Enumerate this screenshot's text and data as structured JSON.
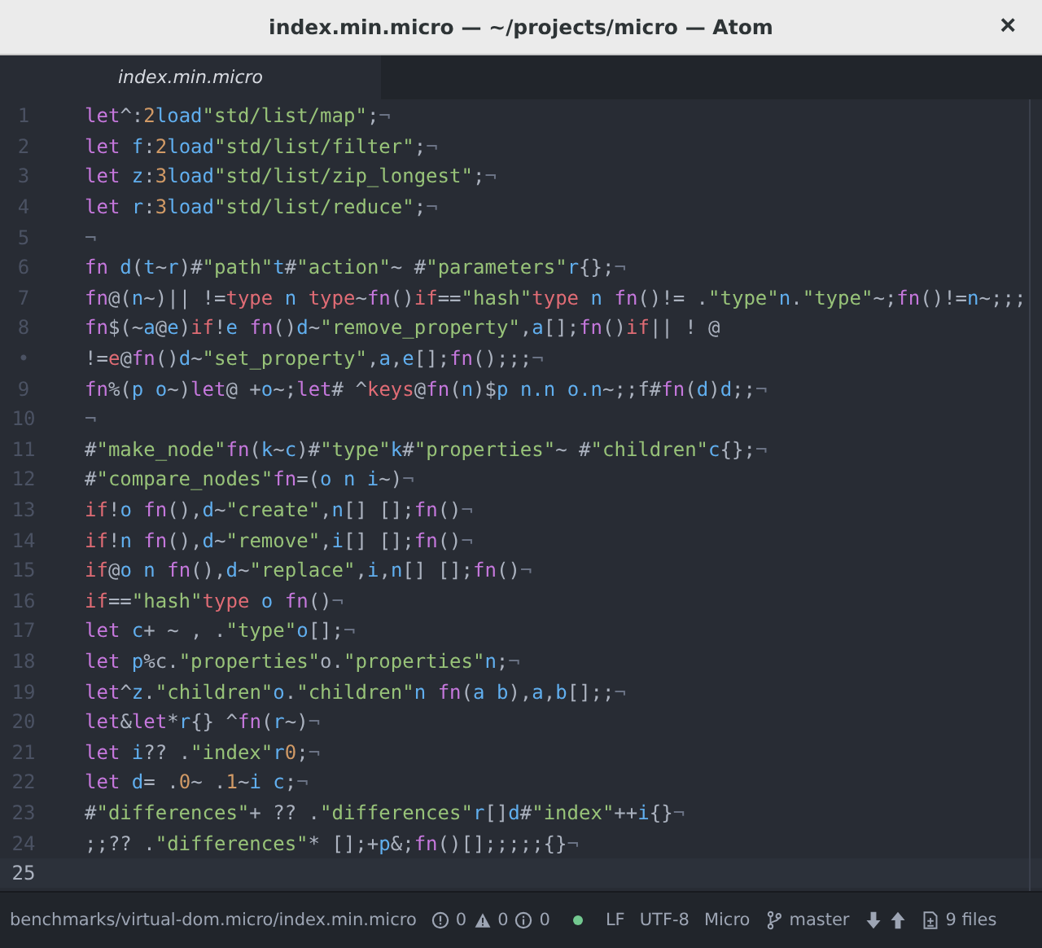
{
  "window": {
    "title": "index.min.micro — ~/projects/micro — Atom",
    "close": "×"
  },
  "tabs": [
    {
      "label": "index.min.micro",
      "selected": true
    }
  ],
  "editor": {
    "lines": [
      {
        "number": "1",
        "current": false,
        "tokens": [
          {
            "kind": "kw",
            "text": "let"
          },
          {
            "kind": "plain",
            "text": "^:"
          },
          {
            "kind": "num",
            "text": "2"
          },
          {
            "kind": "var",
            "text": "load"
          },
          {
            "kind": "str",
            "text": "\"std/list/map\""
          },
          {
            "kind": "plain",
            "text": ";"
          },
          {
            "kind": "invisible",
            "text": "¬"
          }
        ]
      },
      {
        "number": "2",
        "current": false,
        "tokens": [
          {
            "kind": "kw",
            "text": "let"
          },
          {
            "kind": "var",
            "text": " f"
          },
          {
            "kind": "plain",
            "text": ":"
          },
          {
            "kind": "num",
            "text": "2"
          },
          {
            "kind": "var",
            "text": "load"
          },
          {
            "kind": "str",
            "text": "\"std/list/filter\""
          },
          {
            "kind": "plain",
            "text": ";"
          },
          {
            "kind": "invisible",
            "text": "¬"
          }
        ]
      },
      {
        "number": "3",
        "current": false,
        "tokens": [
          {
            "kind": "kw",
            "text": "let"
          },
          {
            "kind": "var",
            "text": " z"
          },
          {
            "kind": "plain",
            "text": ":"
          },
          {
            "kind": "num",
            "text": "3"
          },
          {
            "kind": "var",
            "text": "load"
          },
          {
            "kind": "str",
            "text": "\"std/list/zip_longest\""
          },
          {
            "kind": "plain",
            "text": ";"
          },
          {
            "kind": "invisible",
            "text": "¬"
          }
        ]
      },
      {
        "number": "4",
        "current": false,
        "tokens": [
          {
            "kind": "kw",
            "text": "let"
          },
          {
            "kind": "var",
            "text": " r"
          },
          {
            "kind": "plain",
            "text": ":"
          },
          {
            "kind": "num",
            "text": "3"
          },
          {
            "kind": "var",
            "text": "load"
          },
          {
            "kind": "str",
            "text": "\"std/list/reduce\""
          },
          {
            "kind": "plain",
            "text": ";"
          },
          {
            "kind": "invisible",
            "text": "¬"
          }
        ]
      },
      {
        "number": "5",
        "current": false,
        "tokens": [
          {
            "kind": "invisible",
            "text": "¬"
          }
        ]
      },
      {
        "number": "6",
        "current": false,
        "tokens": [
          {
            "kind": "kw",
            "text": "fn"
          },
          {
            "kind": "var",
            "text": " d"
          },
          {
            "kind": "plain",
            "text": "("
          },
          {
            "kind": "var",
            "text": "t"
          },
          {
            "kind": "plain",
            "text": "~"
          },
          {
            "kind": "var",
            "text": "r"
          },
          {
            "kind": "plain",
            "text": ")#"
          },
          {
            "kind": "str",
            "text": "\"path\""
          },
          {
            "kind": "var",
            "text": "t"
          },
          {
            "kind": "plain",
            "text": "#"
          },
          {
            "kind": "str",
            "text": "\"action\""
          },
          {
            "kind": "plain",
            "text": "~ #"
          },
          {
            "kind": "str",
            "text": "\"parameters\""
          },
          {
            "kind": "var",
            "text": "r"
          },
          {
            "kind": "plain",
            "text": "{};"
          },
          {
            "kind": "invisible",
            "text": "¬"
          }
        ]
      },
      {
        "number": "7",
        "current": false,
        "tokens": [
          {
            "kind": "kw",
            "text": "fn"
          },
          {
            "kind": "plain",
            "text": "@("
          },
          {
            "kind": "var",
            "text": "n"
          },
          {
            "kind": "plain",
            "text": "~)|| !="
          },
          {
            "kind": "ctl",
            "text": "type"
          },
          {
            "kind": "var",
            "text": " n "
          },
          {
            "kind": "ctl",
            "text": "type"
          },
          {
            "kind": "plain",
            "text": "~"
          },
          {
            "kind": "kw",
            "text": "fn"
          },
          {
            "kind": "plain",
            "text": "()"
          },
          {
            "kind": "ctl",
            "text": "if"
          },
          {
            "kind": "plain",
            "text": "=="
          },
          {
            "kind": "str",
            "text": "\"hash\""
          },
          {
            "kind": "ctl",
            "text": "type"
          },
          {
            "kind": "var",
            "text": " n "
          },
          {
            "kind": "kw",
            "text": "fn"
          },
          {
            "kind": "plain",
            "text": "()!= ."
          },
          {
            "kind": "str",
            "text": "\"type\""
          },
          {
            "kind": "var",
            "text": "n"
          },
          {
            "kind": "plain",
            "text": "."
          },
          {
            "kind": "str",
            "text": "\"type\""
          },
          {
            "kind": "plain",
            "text": "~;"
          },
          {
            "kind": "kw",
            "text": "fn"
          },
          {
            "kind": "plain",
            "text": "()!="
          },
          {
            "kind": "var",
            "text": "n"
          },
          {
            "kind": "plain",
            "text": "~;;;"
          }
        ]
      },
      {
        "number": "8",
        "current": false,
        "tokens": [
          {
            "kind": "kw",
            "text": "fn"
          },
          {
            "kind": "plain",
            "text": "$(~"
          },
          {
            "kind": "var",
            "text": "a"
          },
          {
            "kind": "plain",
            "text": "@"
          },
          {
            "kind": "var",
            "text": "e"
          },
          {
            "kind": "plain",
            "text": ")"
          },
          {
            "kind": "ctl",
            "text": "if"
          },
          {
            "kind": "plain",
            "text": "!"
          },
          {
            "kind": "var",
            "text": "e "
          },
          {
            "kind": "kw",
            "text": "fn"
          },
          {
            "kind": "plain",
            "text": "()"
          },
          {
            "kind": "var",
            "text": "d"
          },
          {
            "kind": "plain",
            "text": "~"
          },
          {
            "kind": "str",
            "text": "\"remove_property\""
          },
          {
            "kind": "plain",
            "text": ","
          },
          {
            "kind": "var",
            "text": "a"
          },
          {
            "kind": "plain",
            "text": "[];"
          },
          {
            "kind": "kw",
            "text": "fn"
          },
          {
            "kind": "plain",
            "text": "()"
          },
          {
            "kind": "ctl",
            "text": "if"
          },
          {
            "kind": "plain",
            "text": "|| ! @"
          }
        ]
      },
      {
        "number": "•",
        "current": false,
        "tokens": [
          {
            "kind": "plain",
            "text": "!="
          },
          {
            "kind": "ctl",
            "text": "e"
          },
          {
            "kind": "plain",
            "text": "@"
          },
          {
            "kind": "kw",
            "text": "fn"
          },
          {
            "kind": "plain",
            "text": "()"
          },
          {
            "kind": "var",
            "text": "d"
          },
          {
            "kind": "plain",
            "text": "~"
          },
          {
            "kind": "str",
            "text": "\"set_property\""
          },
          {
            "kind": "plain",
            "text": ","
          },
          {
            "kind": "var",
            "text": "a"
          },
          {
            "kind": "plain",
            "text": ","
          },
          {
            "kind": "var",
            "text": "e"
          },
          {
            "kind": "plain",
            "text": "[];"
          },
          {
            "kind": "kw",
            "text": "fn"
          },
          {
            "kind": "plain",
            "text": "();;;"
          },
          {
            "kind": "invisible",
            "text": "¬"
          }
        ]
      },
      {
        "number": "9",
        "current": false,
        "tokens": [
          {
            "kind": "kw",
            "text": "fn"
          },
          {
            "kind": "plain",
            "text": "%("
          },
          {
            "kind": "var",
            "text": "p o"
          },
          {
            "kind": "plain",
            "text": "~)"
          },
          {
            "kind": "kw",
            "text": "let"
          },
          {
            "kind": "plain",
            "text": "@ +"
          },
          {
            "kind": "var",
            "text": "o"
          },
          {
            "kind": "plain",
            "text": "~;"
          },
          {
            "kind": "kw",
            "text": "let"
          },
          {
            "kind": "plain",
            "text": "# ^"
          },
          {
            "kind": "ctl",
            "text": "keys"
          },
          {
            "kind": "plain",
            "text": "@"
          },
          {
            "kind": "kw",
            "text": "fn"
          },
          {
            "kind": "plain",
            "text": "("
          },
          {
            "kind": "var",
            "text": "n"
          },
          {
            "kind": "plain",
            "text": ")$"
          },
          {
            "kind": "var",
            "text": "p n.n o.n"
          },
          {
            "kind": "plain",
            "text": "~;;f#"
          },
          {
            "kind": "kw",
            "text": "fn"
          },
          {
            "kind": "plain",
            "text": "("
          },
          {
            "kind": "var",
            "text": "d"
          },
          {
            "kind": "plain",
            "text": ")"
          },
          {
            "kind": "var",
            "text": "d"
          },
          {
            "kind": "plain",
            "text": ";;"
          },
          {
            "kind": "invisible",
            "text": "¬"
          }
        ]
      },
      {
        "number": "10",
        "current": false,
        "tokens": [
          {
            "kind": "invisible",
            "text": "¬"
          }
        ]
      },
      {
        "number": "11",
        "current": false,
        "tokens": [
          {
            "kind": "plain",
            "text": "#"
          },
          {
            "kind": "str",
            "text": "\"make_node\""
          },
          {
            "kind": "kw",
            "text": "fn"
          },
          {
            "kind": "plain",
            "text": "("
          },
          {
            "kind": "var",
            "text": "k"
          },
          {
            "kind": "plain",
            "text": "~"
          },
          {
            "kind": "var",
            "text": "c"
          },
          {
            "kind": "plain",
            "text": ")#"
          },
          {
            "kind": "str",
            "text": "\"type\""
          },
          {
            "kind": "var",
            "text": "k"
          },
          {
            "kind": "plain",
            "text": "#"
          },
          {
            "kind": "str",
            "text": "\"properties\""
          },
          {
            "kind": "plain",
            "text": "~ #"
          },
          {
            "kind": "str",
            "text": "\"children\""
          },
          {
            "kind": "var",
            "text": "c"
          },
          {
            "kind": "plain",
            "text": "{};"
          },
          {
            "kind": "invisible",
            "text": "¬"
          }
        ]
      },
      {
        "number": "12",
        "current": false,
        "tokens": [
          {
            "kind": "plain",
            "text": "#"
          },
          {
            "kind": "str",
            "text": "\"compare_nodes\""
          },
          {
            "kind": "kw",
            "text": "fn"
          },
          {
            "kind": "plain",
            "text": "=("
          },
          {
            "kind": "var",
            "text": "o n i"
          },
          {
            "kind": "plain",
            "text": "~)"
          },
          {
            "kind": "invisible",
            "text": "¬"
          }
        ]
      },
      {
        "number": "13",
        "current": false,
        "tokens": [
          {
            "kind": "ctl",
            "text": "if"
          },
          {
            "kind": "plain",
            "text": "!"
          },
          {
            "kind": "var",
            "text": "o "
          },
          {
            "kind": "kw",
            "text": "fn"
          },
          {
            "kind": "plain",
            "text": "(),"
          },
          {
            "kind": "var",
            "text": "d"
          },
          {
            "kind": "plain",
            "text": "~"
          },
          {
            "kind": "str",
            "text": "\"create\""
          },
          {
            "kind": "plain",
            "text": ","
          },
          {
            "kind": "var",
            "text": "n"
          },
          {
            "kind": "plain",
            "text": "[] [];"
          },
          {
            "kind": "kw",
            "text": "fn"
          },
          {
            "kind": "plain",
            "text": "()"
          },
          {
            "kind": "invisible",
            "text": "¬"
          }
        ]
      },
      {
        "number": "14",
        "current": false,
        "tokens": [
          {
            "kind": "ctl",
            "text": "if"
          },
          {
            "kind": "plain",
            "text": "!"
          },
          {
            "kind": "var",
            "text": "n "
          },
          {
            "kind": "kw",
            "text": "fn"
          },
          {
            "kind": "plain",
            "text": "(),"
          },
          {
            "kind": "var",
            "text": "d"
          },
          {
            "kind": "plain",
            "text": "~"
          },
          {
            "kind": "str",
            "text": "\"remove\""
          },
          {
            "kind": "plain",
            "text": ","
          },
          {
            "kind": "var",
            "text": "i"
          },
          {
            "kind": "plain",
            "text": "[] [];"
          },
          {
            "kind": "kw",
            "text": "fn"
          },
          {
            "kind": "plain",
            "text": "()"
          },
          {
            "kind": "invisible",
            "text": "¬"
          }
        ]
      },
      {
        "number": "15",
        "current": false,
        "tokens": [
          {
            "kind": "ctl",
            "text": "if"
          },
          {
            "kind": "plain",
            "text": "@"
          },
          {
            "kind": "var",
            "text": "o n "
          },
          {
            "kind": "kw",
            "text": "fn"
          },
          {
            "kind": "plain",
            "text": "(),"
          },
          {
            "kind": "var",
            "text": "d"
          },
          {
            "kind": "plain",
            "text": "~"
          },
          {
            "kind": "str",
            "text": "\"replace\""
          },
          {
            "kind": "plain",
            "text": ","
          },
          {
            "kind": "var",
            "text": "i"
          },
          {
            "kind": "plain",
            "text": ","
          },
          {
            "kind": "var",
            "text": "n"
          },
          {
            "kind": "plain",
            "text": "[] [];"
          },
          {
            "kind": "kw",
            "text": "fn"
          },
          {
            "kind": "plain",
            "text": "()"
          },
          {
            "kind": "invisible",
            "text": "¬"
          }
        ]
      },
      {
        "number": "16",
        "current": false,
        "tokens": [
          {
            "kind": "ctl",
            "text": "if"
          },
          {
            "kind": "plain",
            "text": "=="
          },
          {
            "kind": "str",
            "text": "\"hash\""
          },
          {
            "kind": "ctl",
            "text": "type"
          },
          {
            "kind": "var",
            "text": " o "
          },
          {
            "kind": "kw",
            "text": "fn"
          },
          {
            "kind": "plain",
            "text": "()"
          },
          {
            "kind": "invisible",
            "text": "¬"
          }
        ]
      },
      {
        "number": "17",
        "current": false,
        "tokens": [
          {
            "kind": "kw",
            "text": "let"
          },
          {
            "kind": "var",
            "text": " c"
          },
          {
            "kind": "plain",
            "text": "+ ~ , ."
          },
          {
            "kind": "str",
            "text": "\"type\""
          },
          {
            "kind": "var",
            "text": "o"
          },
          {
            "kind": "plain",
            "text": "[];"
          },
          {
            "kind": "invisible",
            "text": "¬"
          }
        ]
      },
      {
        "number": "18",
        "current": false,
        "tokens": [
          {
            "kind": "kw",
            "text": "let"
          },
          {
            "kind": "var",
            "text": " p"
          },
          {
            "kind": "plain",
            "text": "%c."
          },
          {
            "kind": "str",
            "text": "\"properties\""
          },
          {
            "kind": "plain",
            "text": "o."
          },
          {
            "kind": "str",
            "text": "\"properties\""
          },
          {
            "kind": "var",
            "text": "n"
          },
          {
            "kind": "plain",
            "text": ";"
          },
          {
            "kind": "invisible",
            "text": "¬"
          }
        ]
      },
      {
        "number": "19",
        "current": false,
        "tokens": [
          {
            "kind": "kw",
            "text": "let"
          },
          {
            "kind": "plain",
            "text": "^"
          },
          {
            "kind": "var",
            "text": "z"
          },
          {
            "kind": "plain",
            "text": "."
          },
          {
            "kind": "str",
            "text": "\"children\""
          },
          {
            "kind": "var",
            "text": "o"
          },
          {
            "kind": "plain",
            "text": "."
          },
          {
            "kind": "str",
            "text": "\"children\""
          },
          {
            "kind": "var",
            "text": "n "
          },
          {
            "kind": "kw",
            "text": "fn"
          },
          {
            "kind": "plain",
            "text": "("
          },
          {
            "kind": "var",
            "text": "a b"
          },
          {
            "kind": "plain",
            "text": "),"
          },
          {
            "kind": "var",
            "text": "a"
          },
          {
            "kind": "plain",
            "text": ","
          },
          {
            "kind": "var",
            "text": "b"
          },
          {
            "kind": "plain",
            "text": "[];;"
          },
          {
            "kind": "invisible",
            "text": "¬"
          }
        ]
      },
      {
        "number": "20",
        "current": false,
        "tokens": [
          {
            "kind": "kw",
            "text": "let"
          },
          {
            "kind": "plain",
            "text": "&"
          },
          {
            "kind": "kw",
            "text": "let"
          },
          {
            "kind": "plain",
            "text": "*"
          },
          {
            "kind": "var",
            "text": "r"
          },
          {
            "kind": "plain",
            "text": "{} ^"
          },
          {
            "kind": "kw",
            "text": "fn"
          },
          {
            "kind": "plain",
            "text": "("
          },
          {
            "kind": "var",
            "text": "r"
          },
          {
            "kind": "plain",
            "text": "~)"
          },
          {
            "kind": "invisible",
            "text": "¬"
          }
        ]
      },
      {
        "number": "21",
        "current": false,
        "tokens": [
          {
            "kind": "kw",
            "text": "let"
          },
          {
            "kind": "var",
            "text": " i"
          },
          {
            "kind": "plain",
            "text": "?? ."
          },
          {
            "kind": "str",
            "text": "\"index\""
          },
          {
            "kind": "var",
            "text": "r"
          },
          {
            "kind": "num",
            "text": "0"
          },
          {
            "kind": "plain",
            "text": ";"
          },
          {
            "kind": "invisible",
            "text": "¬"
          }
        ]
      },
      {
        "number": "22",
        "current": false,
        "tokens": [
          {
            "kind": "kw",
            "text": "let"
          },
          {
            "kind": "var",
            "text": " d"
          },
          {
            "kind": "plain",
            "text": "= ."
          },
          {
            "kind": "num",
            "text": "0"
          },
          {
            "kind": "plain",
            "text": "~ ."
          },
          {
            "kind": "num",
            "text": "1"
          },
          {
            "kind": "plain",
            "text": "~"
          },
          {
            "kind": "var",
            "text": "i c"
          },
          {
            "kind": "plain",
            "text": ";"
          },
          {
            "kind": "invisible",
            "text": "¬"
          }
        ]
      },
      {
        "number": "23",
        "current": false,
        "tokens": [
          {
            "kind": "plain",
            "text": "#"
          },
          {
            "kind": "str",
            "text": "\"differences\""
          },
          {
            "kind": "plain",
            "text": "+ ?? ."
          },
          {
            "kind": "str",
            "text": "\"differences\""
          },
          {
            "kind": "var",
            "text": "r"
          },
          {
            "kind": "plain",
            "text": "[]"
          },
          {
            "kind": "var",
            "text": "d"
          },
          {
            "kind": "plain",
            "text": "#"
          },
          {
            "kind": "str",
            "text": "\"index\""
          },
          {
            "kind": "plain",
            "text": "++"
          },
          {
            "kind": "var",
            "text": "i"
          },
          {
            "kind": "plain",
            "text": "{}"
          },
          {
            "kind": "invisible",
            "text": "¬"
          }
        ]
      },
      {
        "number": "24",
        "current": false,
        "tokens": [
          {
            "kind": "plain",
            "text": ";;?? ."
          },
          {
            "kind": "str",
            "text": "\"differences\""
          },
          {
            "kind": "plain",
            "text": "* [];+"
          },
          {
            "kind": "var",
            "text": "p"
          },
          {
            "kind": "plain",
            "text": "&;"
          },
          {
            "kind": "kw",
            "text": "fn"
          },
          {
            "kind": "plain",
            "text": "()[];;;;;{}"
          },
          {
            "kind": "invisible",
            "text": "¬"
          }
        ]
      },
      {
        "number": "25",
        "current": true
      }
    ]
  },
  "status_bar": {
    "path": "benchmarks/virtual-dom.micro/index.min.micro",
    "errors": "0",
    "warnings": "0",
    "infos": "0",
    "line_ending": "LF",
    "encoding": "UTF-8",
    "grammar": "Micro",
    "branch": "master",
    "files": "9 files"
  }
}
